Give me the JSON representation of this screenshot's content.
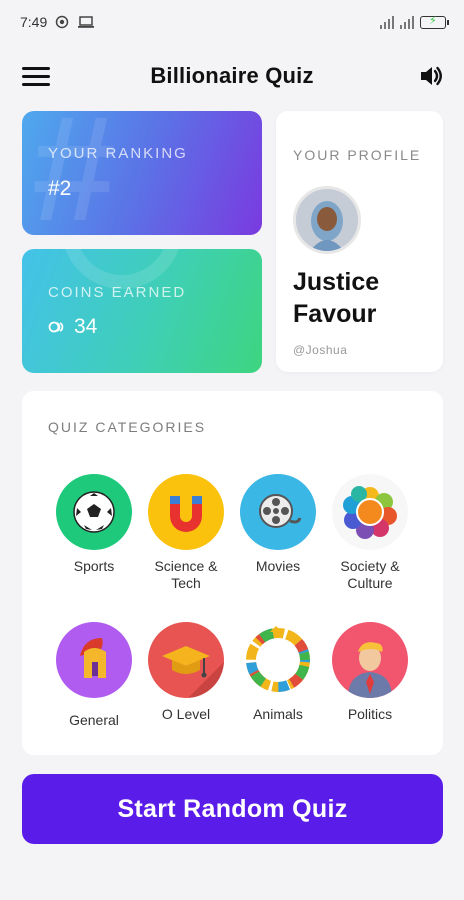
{
  "status": {
    "time": "7:49",
    "icons": [
      "record-icon",
      "laptop-icon",
      "signal-icon",
      "signal-icon",
      "battery-charging-icon"
    ]
  },
  "header": {
    "title": "Billionaire Quiz",
    "menu_icon": "hamburger-menu-icon",
    "sound_icon": "speaker-volume-icon"
  },
  "ranking": {
    "label": "YOUR RANKING",
    "value": "#2"
  },
  "coins": {
    "label": "COINS EARNED",
    "value": "34"
  },
  "profile": {
    "label": "YOUR PROFILE",
    "name_line1": "Justice",
    "name_line2": "Favour",
    "handle": "@Joshua"
  },
  "categories": {
    "heading": "QUIZ CATEGORIES",
    "items": [
      {
        "label": "Sports",
        "color": "#1ec97b"
      },
      {
        "label": "Science & Tech",
        "color": "#fbc20d"
      },
      {
        "label": "Movies",
        "color": "#3bb7e6"
      },
      {
        "label": "Society & Culture",
        "color": "#f7f7f7"
      },
      {
        "label": "General",
        "color": "#b05cf0"
      },
      {
        "label": "O Level",
        "color": "#e85451"
      },
      {
        "label": "Animals",
        "color": "#ffffff"
      },
      {
        "label": "Politics",
        "color": "#f2566f"
      }
    ]
  },
  "start_button": {
    "label": "Start Random Quiz",
    "color": "#5a1de9"
  }
}
